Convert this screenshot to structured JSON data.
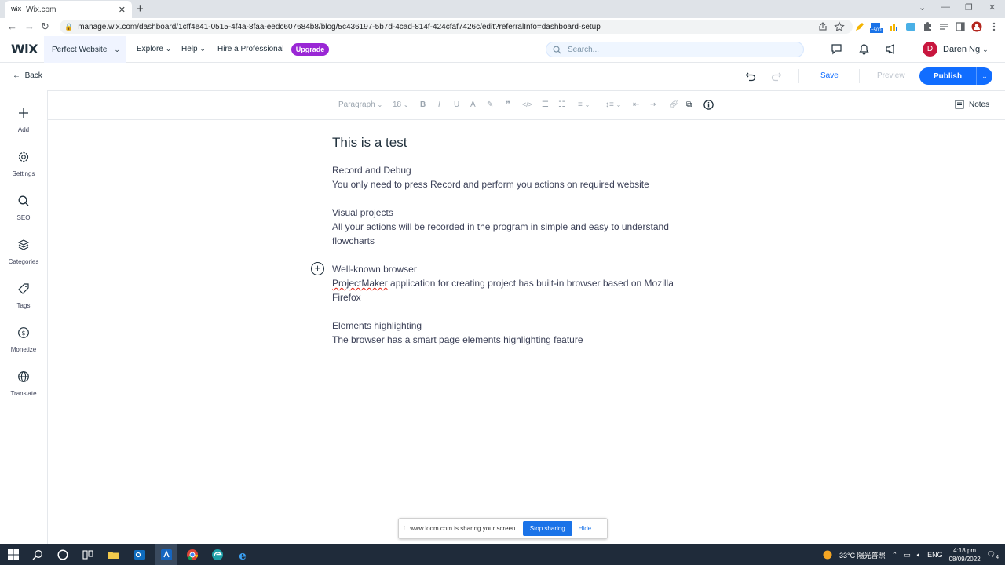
{
  "browser": {
    "tab_title": "Wix.com",
    "tab_favicon": "WiX",
    "url": "manage.wix.com/dashboard/1cff4e41-0515-4f4a-8faa-eedc607684b8/blog/5c436197-5b7d-4cad-814f-424cfaf7426c/edit?referralInfo=dashboard-setup",
    "ext_badge": "+500"
  },
  "topbar": {
    "logo": "WiX",
    "site_name": "Perfect Website",
    "nav": [
      "Explore",
      "Help",
      "Hire a Professional"
    ],
    "upgrade_label": "Upgrade",
    "search_placeholder": "Search...",
    "user_initial": "D",
    "user_name": "Daren Ng"
  },
  "actionbar": {
    "back_label": "Back",
    "save_label": "Save",
    "preview_label": "Preview",
    "publish_label": "Publish"
  },
  "sidebar": {
    "items": [
      {
        "label": "Add",
        "icon": "plus-icon"
      },
      {
        "label": "Settings",
        "icon": "gear-icon"
      },
      {
        "label": "SEO",
        "icon": "search-icon"
      },
      {
        "label": "Categories",
        "icon": "categories-icon"
      },
      {
        "label": "Tags",
        "icon": "tag-icon"
      },
      {
        "label": "Monetize",
        "icon": "dollar-icon"
      },
      {
        "label": "Translate",
        "icon": "globe-icon"
      }
    ]
  },
  "toolbar": {
    "paragraph_style": "Paragraph",
    "font_size": "18",
    "notes_label": "Notes"
  },
  "content": {
    "title": "This is a test",
    "sections": [
      {
        "heading": "Record and Debug",
        "body": "You only need to press Record and perform you actions on required website"
      },
      {
        "heading": "Visual projects",
        "body": "All your actions will be recorded in the program in simple and easy to understand flowcharts"
      },
      {
        "heading": "Well-known browser",
        "body_word": "ProjectMaker",
        "body_rest": " application for creating project has built-in browser based on Mozilla Firefox"
      },
      {
        "heading": "Elements highlighting",
        "body": "The browser has a smart page elements highlighting feature"
      }
    ]
  },
  "loom": {
    "message": "www.loom.com is sharing your screen.",
    "stop_label": "Stop sharing",
    "hide_label": "Hide"
  },
  "taskbar": {
    "weather": "33°C 陽光普照",
    "lang": "ENG",
    "time": "4:18 pm",
    "date": "08/09/2022",
    "notif_count": "4"
  },
  "colors": {
    "accent": "#116dff",
    "upgrade": "#9a27d5",
    "avatar": "#c8163e",
    "taskbar": "#1f2b3a"
  }
}
